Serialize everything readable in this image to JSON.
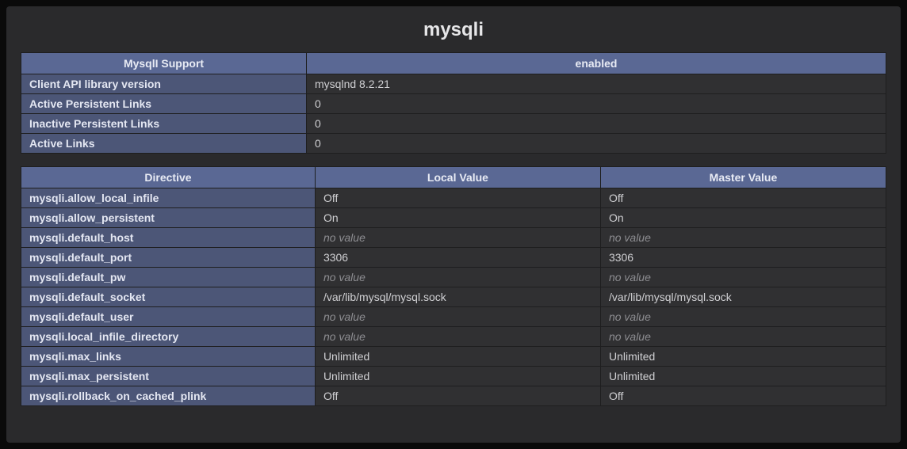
{
  "title": "mysqli",
  "no_value_text": "no value",
  "support_table": {
    "header_left": "MysqlI Support",
    "header_right": "enabled",
    "rows": [
      {
        "name": "Client API library version",
        "value": "mysqlnd 8.2.21"
      },
      {
        "name": "Active Persistent Links",
        "value": "0"
      },
      {
        "name": "Inactive Persistent Links",
        "value": "0"
      },
      {
        "name": "Active Links",
        "value": "0"
      }
    ]
  },
  "directives_table": {
    "header_directive": "Directive",
    "header_local": "Local Value",
    "header_master": "Master Value",
    "rows": [
      {
        "name": "mysqli.allow_local_infile",
        "local": "Off",
        "master": "Off"
      },
      {
        "name": "mysqli.allow_persistent",
        "local": "On",
        "master": "On"
      },
      {
        "name": "mysqli.default_host",
        "local": null,
        "master": null
      },
      {
        "name": "mysqli.default_port",
        "local": "3306",
        "master": "3306"
      },
      {
        "name": "mysqli.default_pw",
        "local": null,
        "master": null
      },
      {
        "name": "mysqli.default_socket",
        "local": "/var/lib/mysql/mysql.sock",
        "master": "/var/lib/mysql/mysql.sock"
      },
      {
        "name": "mysqli.default_user",
        "local": null,
        "master": null
      },
      {
        "name": "mysqli.local_infile_directory",
        "local": null,
        "master": null
      },
      {
        "name": "mysqli.max_links",
        "local": "Unlimited",
        "master": "Unlimited"
      },
      {
        "name": "mysqli.max_persistent",
        "local": "Unlimited",
        "master": "Unlimited"
      },
      {
        "name": "mysqli.rollback_on_cached_plink",
        "local": "Off",
        "master": "Off"
      }
    ]
  }
}
